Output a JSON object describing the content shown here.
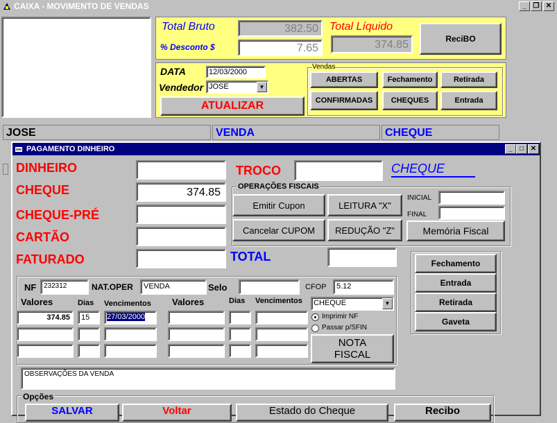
{
  "window": {
    "title": "CAIXA - MOVIMENTO DE VENDAS"
  },
  "totals": {
    "bruto_label": "Total Bruto",
    "bruto_value": "382.50",
    "desconto_label": "% Desconto $",
    "desconto_value": "7.65",
    "liquido_label": "Total Líquido",
    "liquido_value": "374.85",
    "recibo_label": "ReciBO"
  },
  "filter": {
    "data_label": "DATA",
    "data_value": "12/03/2000",
    "vendedor_label": "Vendedor",
    "vendedor_value": "JOSE",
    "atualizar_label": "ATUALIZAR",
    "vendas_group": "Vendas",
    "abertas": "ABERTAS",
    "confirmadas": "CONFIRMADAS",
    "fechamento": "Fechamento",
    "cheques": "CHEQUES",
    "retirada": "Retirada",
    "entrada": "Entrada"
  },
  "grid_header": {
    "col1": "JOSE",
    "col2": "VENDA",
    "col3": "CHEQUE"
  },
  "dialog": {
    "title": "PAGAMENTO DINHEIRO",
    "dinheiro_label": "DINHEIRO",
    "dinheiro_value": "",
    "cheque_label": "CHEQUE",
    "cheque_value": "374.85",
    "chequepre_label": "CHEQUE-PRÉ",
    "chequepre_value": "",
    "cartao_label": "CARTÃO",
    "cartao_value": "",
    "faturado_label": "FATURADO",
    "faturado_value": "",
    "troco_label": "TROCO",
    "troco_value": "",
    "cheque_link": "CHEQUE",
    "fiscal_group": "OPERAÇÕES FISCAIS",
    "emitir_cupon": "Emitir Cupon",
    "leitura_x": "LEITURA \"X\"",
    "cancelar_cupom": "Cancelar CUPOM",
    "reducao_z": "REDUÇÃO \"Z\"",
    "inicial_label": "INICIAL",
    "final_label": "FINAL",
    "memoria_fiscal": "Memória Fiscal",
    "total_label": "TOTAL",
    "total_value": "",
    "side_fechamento": "Fechamento",
    "side_entrada": "Entrada",
    "side_retirada": "Retirada",
    "side_gaveta": "Gaveta",
    "nf_label": "NF",
    "nf_value": "232312",
    "natoper_label": "NAT.OPER",
    "natoper_value": "VENDA",
    "selo_label": "Selo",
    "selo_value": "",
    "cfop_label": "CFOP",
    "cfop_value": "5.12",
    "payment_select": "CHEQUE",
    "col_valores": "Valores",
    "col_dias": "Dias",
    "col_venc": "Vencimentos",
    "row1": {
      "valor": "374.85",
      "dias": "15",
      "venc": "27/03/2000"
    },
    "imprimir_nf": "Imprimir NF",
    "passar_sfin": "Passar p/SFIN",
    "nota_fiscal_1": "NOTA",
    "nota_fiscal_2": "FISCAL",
    "observacoes": "OBSERVAÇÕES DA VENDA",
    "opcoes_label": "Opções",
    "salvar": "SALVAR",
    "voltar": "Voltar",
    "estado": "Estado do Cheque",
    "recibo": "Recibo"
  },
  "colors": {
    "titlebar": "#000080",
    "yellow": "#ffff80",
    "red": "#ff0000",
    "blue": "#0000ff"
  }
}
